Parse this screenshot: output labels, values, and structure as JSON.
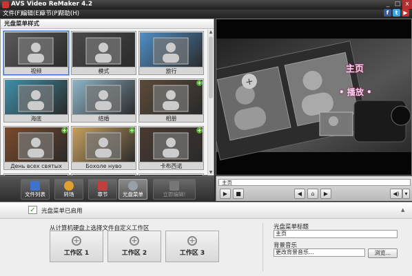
{
  "window": {
    "title": "AVS Video ReMaker 4.2",
    "controls": [
      "_",
      "□",
      "x"
    ]
  },
  "menu": [
    "文件(F)",
    "编辑(E)",
    "章节(P)",
    "帮助(H)"
  ],
  "social": [
    {
      "glyph": "f",
      "color": "#3b5998"
    },
    {
      "glyph": "t",
      "color": "#3aa6e6"
    },
    {
      "glyph": "▶",
      "color": "#c4302b"
    }
  ],
  "left_panel": {
    "title": "光盘菜单样式",
    "styles": [
      {
        "label": "视频",
        "selected": true,
        "has_add": false,
        "tint": "#5a5a5a"
      },
      {
        "label": "模式",
        "selected": false,
        "has_add": false,
        "tint": "#4a4a4a"
      },
      {
        "label": "旅行",
        "selected": false,
        "has_add": false,
        "tint": "#4f8fc6"
      },
      {
        "label": "海底",
        "selected": false,
        "has_add": false,
        "tint": "#3f8fa8"
      },
      {
        "label": "结婚",
        "selected": false,
        "has_add": false,
        "tint": "#8fb6c8"
      },
      {
        "label": "相册",
        "selected": false,
        "has_add": true,
        "tint": "#5c4a38"
      },
      {
        "label": "День всех святых",
        "selected": false,
        "has_add": true,
        "tint": "#7a4a2a"
      },
      {
        "label": "Бохоле нуво",
        "selected": false,
        "has_add": true,
        "tint": "#c8a060"
      },
      {
        "label": "卡布西诺",
        "selected": false,
        "has_add": true,
        "tint": "#4a3a30"
      },
      {
        "label": "",
        "selected": false,
        "has_add": false,
        "tint": "#666666"
      },
      {
        "label": "",
        "selected": false,
        "has_add": false,
        "tint": "#666666"
      },
      {
        "label": "",
        "selected": false,
        "has_add": false,
        "tint": "#666666"
      }
    ]
  },
  "preview": {
    "main_label": "主页",
    "play_label": "• 播放 •"
  },
  "toolbar": [
    {
      "label": "文件列表",
      "icon": "file-list-icon",
      "color": "#3f72c8",
      "active": false,
      "disabled": false
    },
    {
      "label": "转场",
      "icon": "transition-icon",
      "color": "#e0a030",
      "active": false,
      "disabled": false
    },
    {
      "label": "章节",
      "icon": "chapter-icon",
      "color": "#c04040",
      "active": false,
      "disabled": false
    },
    {
      "label": "光盘菜单",
      "icon": "disc-menu-icon",
      "color": "#9aa0a8",
      "active": true,
      "disabled": false
    },
    {
      "label": "立即编辑!",
      "icon": "edit-now-icon",
      "color": "#777777",
      "active": false,
      "disabled": true
    }
  ],
  "player": {
    "timeline_chapter": "主页",
    "play_glyph": "▶",
    "stop_glyph": "■",
    "prev_glyph": "◀",
    "home_glyph": "⌂",
    "next_glyph": "▶",
    "volume_glyph": "◀)",
    "volume_dropdown": "▾"
  },
  "disc_menu": {
    "enabled_label": "光盘菜单已启用",
    "enabled": true,
    "collapse_glyph": "▲",
    "workspace_hint": "从计算机硬盘上选择文件自定义工作区",
    "workspaces": [
      "工作区 1",
      "工作区 2",
      "工作区 3"
    ],
    "title_label": "光盘菜单标题",
    "title_value": "主页",
    "music_label": "背景音乐",
    "music_placeholder": "更改背景音乐...",
    "browse_label": "浏览..."
  }
}
